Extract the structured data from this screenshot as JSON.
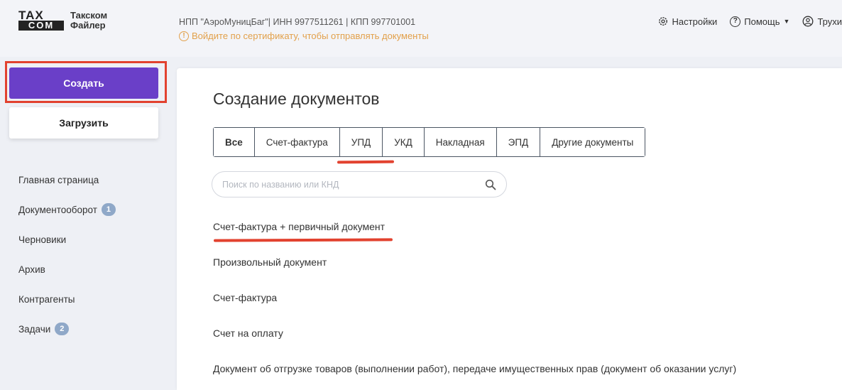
{
  "header": {
    "logo_top": "TAX",
    "logo_bottom": "COM",
    "product_line1": "Такском",
    "product_line2": "Файлер",
    "org_info": "НПП \"АэроМуницБаг\"| ИНН 9977511261 | КПП 997701001",
    "warning_icon": "!",
    "warning_text": "Войдите по сертификату, чтобы отправлять документы",
    "nav": {
      "settings": "Настройки",
      "help": "Помощь",
      "help_icon": "?",
      "user": "Трухи"
    }
  },
  "sidebar": {
    "create_label": "Создать",
    "upload_label": "Загрузить",
    "items": [
      {
        "label": "Главная страница",
        "badge": ""
      },
      {
        "label": "Документооборот",
        "badge": "1"
      },
      {
        "label": "Черновики",
        "badge": ""
      },
      {
        "label": "Архив",
        "badge": ""
      },
      {
        "label": "Контрагенты",
        "badge": ""
      },
      {
        "label": "Задачи",
        "badge": "2"
      }
    ]
  },
  "main": {
    "title": "Создание документов",
    "tabs": [
      {
        "label": "Все"
      },
      {
        "label": "Счет-фактура"
      },
      {
        "label": "УПД"
      },
      {
        "label": "УКД"
      },
      {
        "label": "Накладная"
      },
      {
        "label": "ЭПД"
      },
      {
        "label": "Другие документы"
      }
    ],
    "search_placeholder": "Поиск по названию или КНД",
    "documents": [
      "Счет-фактура + первичный документ",
      "Произвольный документ",
      "Счет-фактура",
      "Счет на оплату",
      "Документ об отгрузке товаров (выполнении работ), передаче имущественных прав (документ об оказании услуг)"
    ]
  },
  "colors": {
    "accent": "#6a3fc8",
    "warning": "#e2a04a",
    "highlight": "#e2422f",
    "badge": "#8fa8c8"
  }
}
